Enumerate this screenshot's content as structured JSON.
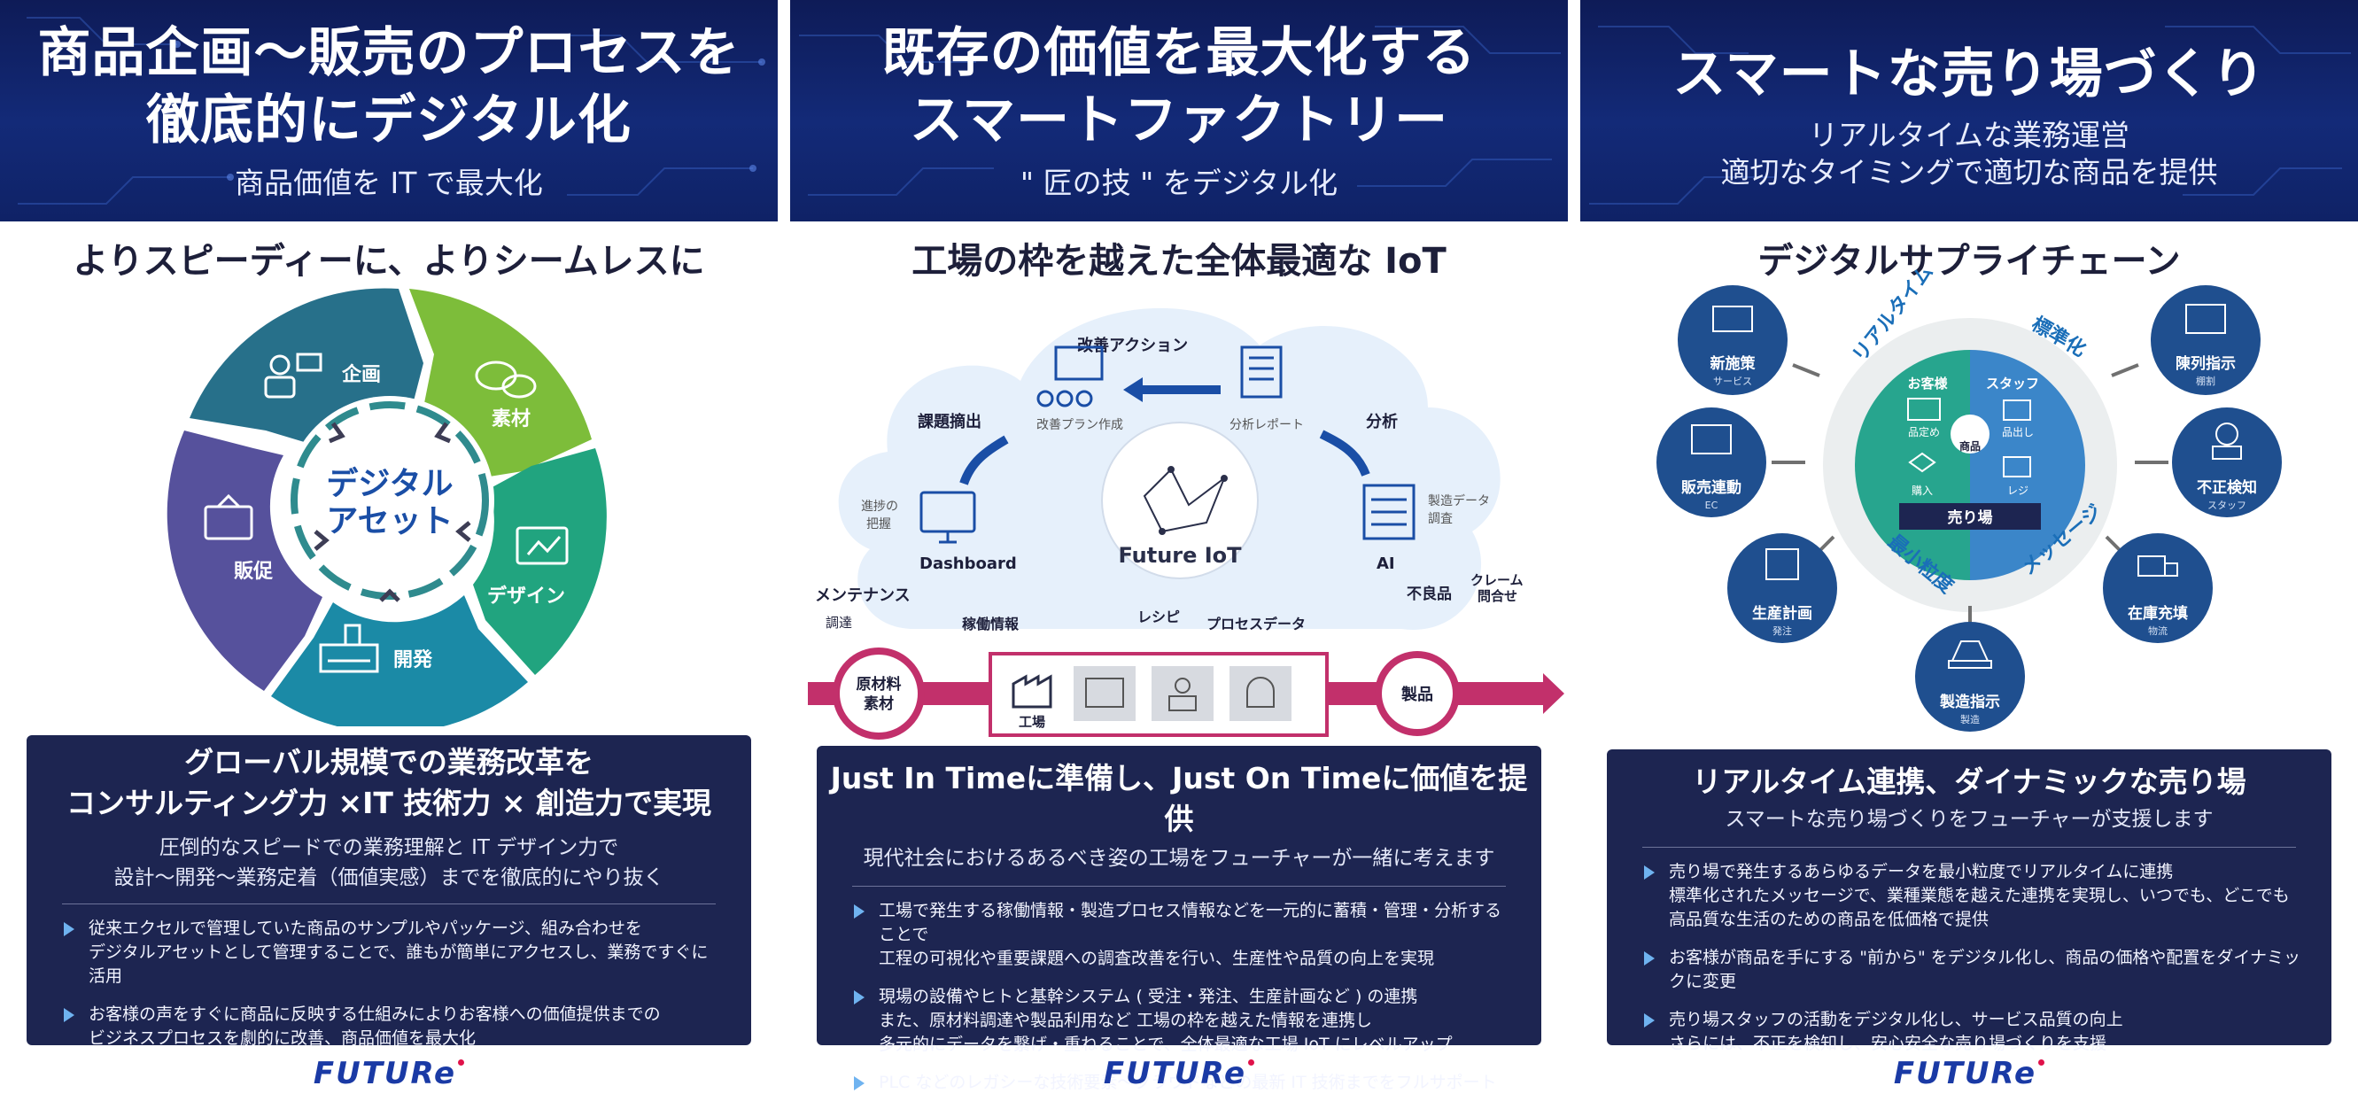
{
  "brand": {
    "logo": "FUTURe",
    "colors": {
      "navy": "#1d2551",
      "hero": "#132a78",
      "accent_red": "#e0124a",
      "pink": "#c2306b"
    }
  },
  "columns": [
    {
      "title_lines": [
        "商品企画〜販売のプロセスを",
        "徹底的にデジタル化"
      ],
      "subtitle": "商品価値を IT で最大化",
      "section_title": "よりスピーディーに、よりシームレスに",
      "wheel": {
        "center_lines": [
          "デジタル",
          "アセット"
        ],
        "segments": [
          "企画",
          "素材",
          "デザイン",
          "開発",
          "販促"
        ]
      },
      "panel": {
        "heading_lines": [
          "グローバル規模での業務改革を",
          "コンサルティング力 ×IT 技術力 × 創造力で実現"
        ],
        "sub_lines": [
          "圧倒的なスピードでの業務理解と IT デザイン力で",
          "設計〜開発〜業務定着（価値実感）までを徹底的にやり抜く"
        ],
        "bullets": [
          [
            "従来エクセルで管理していた商品のサンプルやパッケージ、組み合わせを",
            "デジタルアセットとして管理することで、誰もが簡単にアクセスし、業務ですぐに活用"
          ],
          [
            "お客様の声をすぐに商品に反映する仕組みによりお客様への価値提供までの",
            "ビジネスプロセスを劇的に改善、商品価値を最大化"
          ]
        ]
      }
    },
    {
      "title_lines": [
        "既存の価値を最大化する",
        "スマートファクトリー"
      ],
      "subtitle": "\" 匠の技 \" をデジタル化",
      "section_title": "工場の枠を越えた全体最適な IoT",
      "iot": {
        "center": "Future IoT",
        "kaizen_action": "改善アクション",
        "kaizen_plan": "改善プラン作成",
        "report": "分析レポート",
        "kadai": "課題摘出",
        "bunseki": "分析",
        "shinchoku_lines": [
          "進捗の",
          "把握"
        ],
        "dashboard": "Dashboard",
        "seizo_lines": [
          "製造データ",
          "調査"
        ],
        "ai": "AI",
        "maintenance": "メンテナンス",
        "chotatsu": "調達",
        "kado": "稼働情報",
        "recipe": "レシピ",
        "process": "プロセスデータ",
        "furyo": "不良品",
        "claim_lines": [
          "クレーム",
          "問合せ"
        ],
        "raw_lines": [
          "原材料",
          "素材"
        ],
        "factory": "工場",
        "product": "製品"
      },
      "panel": {
        "heading_lines": [
          "Just In Timeに準備し、Just On Timeに価値を提供"
        ],
        "sub_lines": [
          "現代社会におけるあるべき姿の工場をフューチャーが一緒に考えます"
        ],
        "bullets": [
          [
            "工場で発生する稼働情報・製造プロセス情報などを一元的に蓄積・管理・分析することで",
            "工程の可視化や重要課題への調査改善を行い、生産性や品質の向上を実現"
          ],
          [
            "現場の設備やヒトと基幹システム ( 受注・発注、生産計画など ) の連携",
            "また、原材料調達や製品利用など 工場の枠を越えた情報を連携し",
            "多元的にデータを繋げ・重ねることで、全体最適な工場 IoT にレベルアップ"
          ],
          [
            "PLC などのレガシーな技術要素〜クラウドなどの最新 IT 技術までをフルサポート"
          ]
        ]
      }
    },
    {
      "title_lines": [
        "スマートな売り場づくり"
      ],
      "subtitle_lines": [
        "リアルタイムな業務運営",
        "適切なタイミングで適切な商品を提供"
      ],
      "section_title": "デジタルサプライチェーン",
      "supply": {
        "ring_labels": [
          "リアルタイム",
          "標準化",
          "最小粒度",
          "メッセージ"
        ],
        "inner": {
          "customer": "お客様",
          "staff": "スタッフ",
          "hinsadame": "品定め",
          "shohin": "商品",
          "hindashi": "品出し",
          "konyu": "購入",
          "reji": "レジ",
          "uriba": "売り場"
        },
        "nodes": [
          {
            "label": "新施策",
            "sub": "サービス"
          },
          {
            "label": "陳列指示",
            "sub": "棚割"
          },
          {
            "label": "販売連動",
            "sub": "EC"
          },
          {
            "label": "不正検知",
            "sub": "スタッフ"
          },
          {
            "label": "生産計画",
            "sub": "発注"
          },
          {
            "label": "在庫充填",
            "sub": "物流"
          },
          {
            "label": "製造指示",
            "sub": "製造"
          }
        ]
      },
      "panel": {
        "heading_lines": [
          "リアルタイム連携、ダイナミックな売り場"
        ],
        "sub_lines": [
          "スマートな売り場づくりをフューチャーが支援します"
        ],
        "bullets": [
          [
            "売り場で発生するあらゆるデータを最小粒度でリアルタイムに連携",
            "標準化されたメッセージで、業種業態を越えた連携を実現し、いつでも、どこでも",
            "高品質な生活のための商品を低価格で提供"
          ],
          [
            "お客様が商品を手にする \"前から\" をデジタル化し、商品の価格や配置をダイナミックに変更"
          ],
          [
            "売り場スタッフの活動をデジタル化し、サービス品質の向上",
            "さらには、不正を検知し、安心安全な売り場づくりを支援"
          ]
        ]
      }
    }
  ]
}
